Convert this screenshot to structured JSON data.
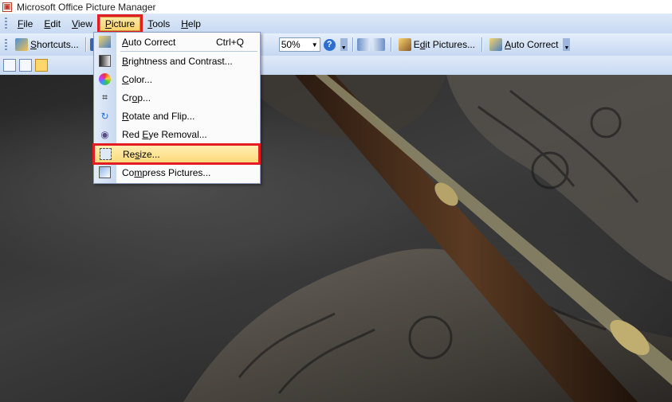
{
  "window": {
    "title": "Microsoft Office Picture Manager"
  },
  "menubar": {
    "items": [
      {
        "label": "File",
        "accel": "F",
        "rest": "ile"
      },
      {
        "label": "Edit",
        "accel": "E",
        "rest": "dit"
      },
      {
        "label": "View",
        "accel": "V",
        "rest": "iew"
      },
      {
        "label": "Picture",
        "accel": "P",
        "rest": "icture"
      },
      {
        "label": "Tools",
        "accel": "T",
        "rest": "ools"
      },
      {
        "label": "Help",
        "accel": "H",
        "rest": "elp"
      }
    ]
  },
  "toolbar": {
    "shortcuts": {
      "accel": "S",
      "rest": "hortcuts..."
    },
    "zoom_value": "50%",
    "help": "?",
    "edit_pictures": {
      "pre": "E",
      "accel": "d",
      "rest": "it Pictures..."
    },
    "auto_correct": {
      "accel": "A",
      "rest": "uto Correct"
    }
  },
  "picture_menu": {
    "items": [
      {
        "label": "Auto Correct",
        "accel": "A",
        "rest": "uto Correct",
        "shortcut": "Ctrl+Q",
        "icon": "auto-correct-icon"
      },
      {
        "label": "Brightness and Contrast...",
        "accel": "B",
        "rest": "rightness and Contrast...",
        "icon": "brightness-icon"
      },
      {
        "label": "Color...",
        "accel": "C",
        "rest": "olor...",
        "icon": "color-wheel-icon"
      },
      {
        "label": "Crop...",
        "pre": "Cr",
        "accel": "o",
        "rest": "p...",
        "icon": "crop-icon"
      },
      {
        "label": "Rotate and Flip...",
        "accel": "R",
        "rest": "otate and Flip...",
        "icon": "rotate-icon"
      },
      {
        "label": "Red Eye Removal...",
        "pre": "Red ",
        "accel": "E",
        "rest": "ye Removal...",
        "icon": "red-eye-icon"
      },
      {
        "label": "Resize...",
        "pre": "Re",
        "accel": "s",
        "rest": "ize...",
        "icon": "resize-icon"
      },
      {
        "label": "Compress Pictures...",
        "pre": "Co",
        "accel": "m",
        "rest": "press Pictures...",
        "icon": "compress-icon"
      }
    ]
  },
  "colors": {
    "highlight": "#e31b23",
    "menu_hover": "#fcd97a",
    "bar": "#c7daf2"
  }
}
